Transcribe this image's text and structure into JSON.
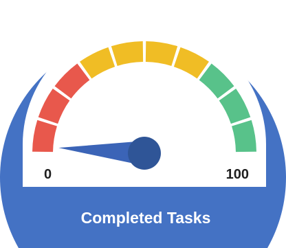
{
  "chart_data": {
    "type": "gauge",
    "title": "Completed Tasks",
    "min": 0,
    "max": 100,
    "value": 2,
    "min_label": "0",
    "max_label": "100",
    "bands": [
      {
        "color": "#e8584c",
        "segments": 3
      },
      {
        "color": "#f0bd25",
        "segments": 4
      },
      {
        "color": "#58c28a",
        "segments": 3
      }
    ],
    "colors": {
      "frame": "#4472c4",
      "dial": "#ffffff",
      "needle": "#3b64b7",
      "hub": "#2f5597"
    }
  }
}
